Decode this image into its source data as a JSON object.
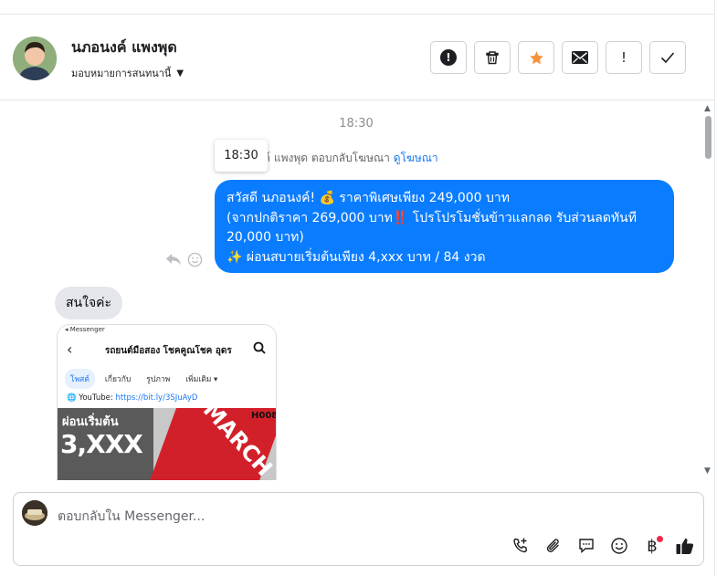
{
  "header": {
    "name": "นภอนงค์ แพงพุด",
    "assign_label": "มอบหมายการสนทนานี้",
    "actions": [
      {
        "icon": "alert-circle-icon"
      },
      {
        "icon": "trash-icon"
      },
      {
        "icon": "star-icon"
      },
      {
        "icon": "envelope-icon"
      },
      {
        "icon": "exclamation-icon",
        "label": "!"
      },
      {
        "icon": "check-icon"
      }
    ]
  },
  "chat": {
    "timestamp": "18:30",
    "tooltip_time": "18:30",
    "reply_note": "ค์ แพงพุด ตอบกลับโฆษณา",
    "reply_link": "ดูโฆษณา",
    "outgoing": {
      "line1": "สวัสดี นภอนงค์! 💰 ราคาพิเศษเพียง 249,000 บาท",
      "line2": "(จากปกติราคา 269,000 บาท‼️ โปรโปรโมชั่นข้าวแลกลด รับส่วนลดทันที",
      "line3": "20,000 บาท)",
      "line4": "✨ ผ่อนสบายเริ่มต้นเพียง 4,xxx บาท / 84 งวด"
    },
    "incoming_text": "สนใจค่ะ",
    "attachment": {
      "status_bar": "◂ Messenger",
      "page_name": "รถยนต์มือสอง โชคคูณโชค อุดร",
      "tabs": [
        "โพสต์",
        "เกี่ยวกับ",
        "รูปภาพ",
        "เพิ่มเติม ▾"
      ],
      "youtube_label": "YouTube:",
      "youtube_link": "https://bit.ly/3SJuAyD",
      "banner_line1": "ผ่อนเริ่มต้น",
      "banner_line2": "3,XXX",
      "banner_model": "MARCH",
      "banner_code": "H008"
    }
  },
  "composer": {
    "placeholder": "ตอบกลับใน Messenger...",
    "tools": [
      "phone-plus-icon",
      "paperclip-icon",
      "chat-icon",
      "emoji-icon",
      "baht-icon",
      "thumbs-up-icon"
    ]
  }
}
